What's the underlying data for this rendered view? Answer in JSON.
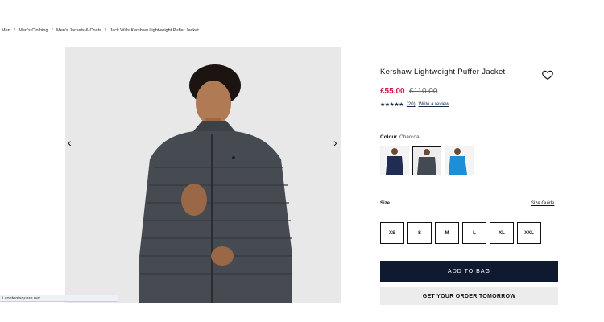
{
  "breadcrumb": {
    "items": [
      "Men",
      "Men's Clothing",
      "Men's Jackets & Coats",
      "Jack Wills Kershaw Lightweight Puffer Jacket"
    ],
    "separator": "/"
  },
  "gallery": {
    "prev_icon": "‹",
    "next_icon": "›"
  },
  "product": {
    "title": "Kershaw Lightweight Puffer Jacket",
    "price_now": "£55.00",
    "price_was": "£110.00",
    "rating_stars": "★★★★★",
    "rating_count": "(20)",
    "write_review": "Write a review",
    "colour_label": "Colour",
    "colour_value": "Charcoal",
    "size_label": "Size",
    "size_guide": "Size Guide",
    "sizes": [
      "XS",
      "S",
      "M",
      "L",
      "XL",
      "XXL"
    ],
    "add_to_bag": "ADD TO BAG",
    "order_promo": "GET YOUR ORDER TOMORROW"
  },
  "status_bar": {
    "text": "i.contentsquare.net..."
  },
  "colors": {
    "price": "#d01a4a",
    "primary_button": "#0f1a30",
    "rating": "#1a2a4a"
  }
}
